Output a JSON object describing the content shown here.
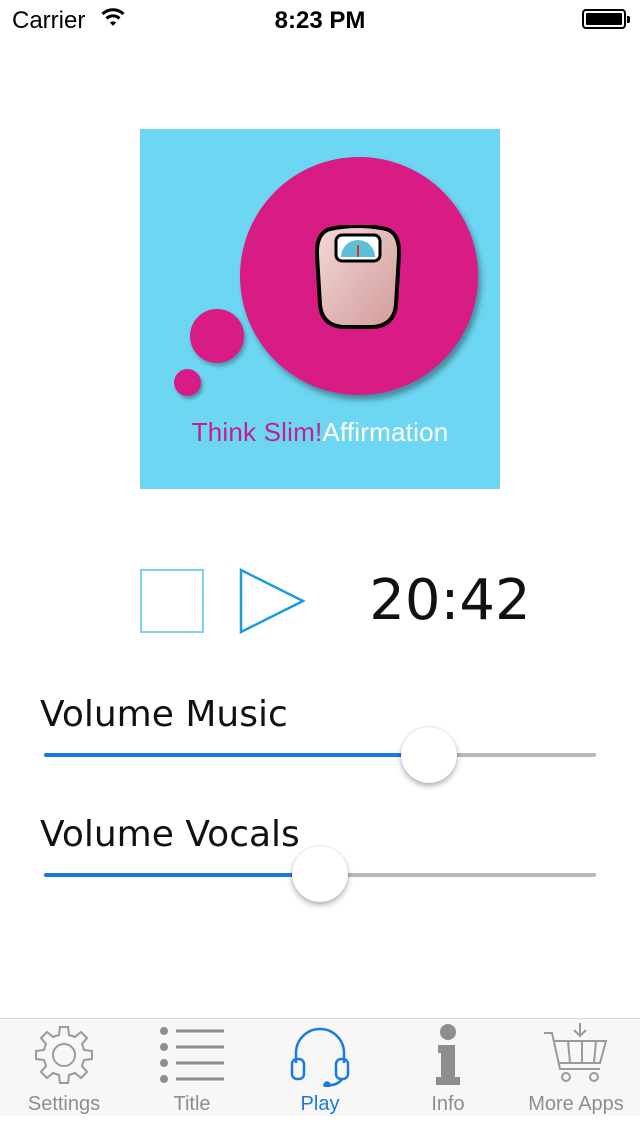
{
  "status_bar": {
    "carrier": "Carrier",
    "time": "8:23 PM",
    "icons": [
      "wifi-icon",
      "battery-icon"
    ]
  },
  "album_art": {
    "title_part1": "Think Slim!",
    "title_part2": "Affirmation",
    "colors": {
      "background": "#6dd6f3",
      "bubble": "#d81b85",
      "title_pink": "#c41f8a"
    }
  },
  "player": {
    "stop_icon": "stop-icon",
    "play_icon": "play-icon",
    "time": "20:42"
  },
  "volume_music": {
    "label": "Volume Music",
    "value": 0.72
  },
  "volume_vocals": {
    "label": "Volume Vocals",
    "value": 0.5
  },
  "tab_bar": {
    "accent": "#1a7ae0",
    "tabs": [
      {
        "label": "Settings",
        "icon": "gear-icon",
        "active": false
      },
      {
        "label": "Title",
        "icon": "list-icon",
        "active": false
      },
      {
        "label": "Play",
        "icon": "headphones-icon",
        "active": true
      },
      {
        "label": "Info",
        "icon": "info-icon",
        "active": false
      },
      {
        "label": "More Apps",
        "icon": "cart-icon",
        "active": false
      }
    ]
  }
}
